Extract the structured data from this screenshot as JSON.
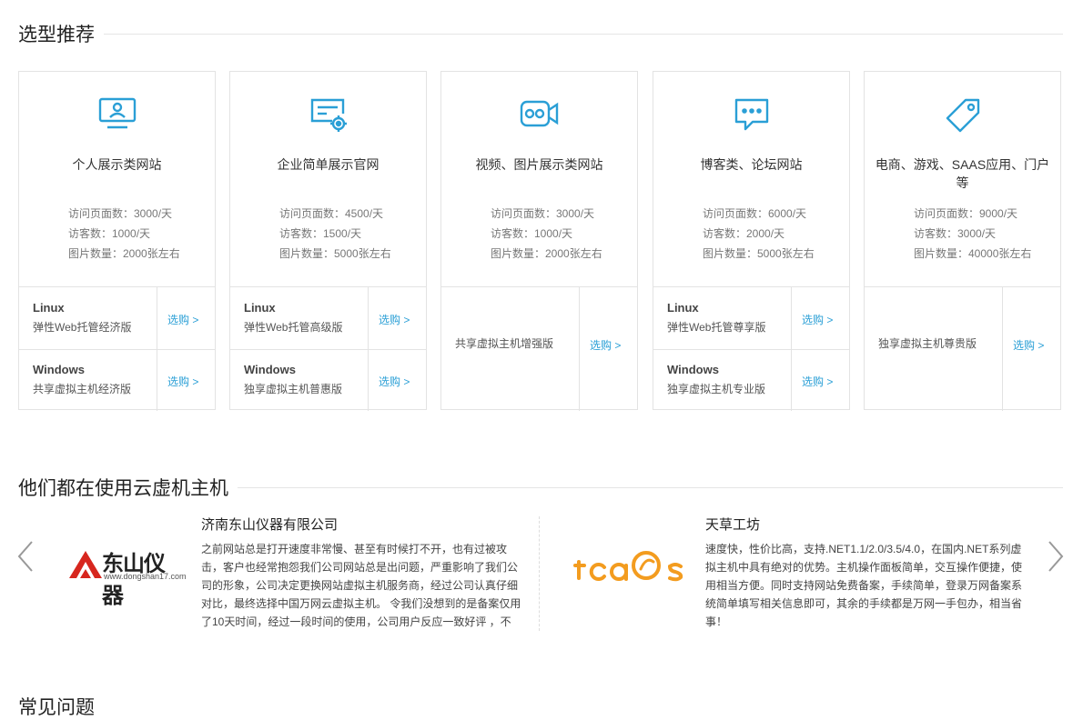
{
  "section1": {
    "title": "选型推荐"
  },
  "cards": [
    {
      "title": "个人展示类网站",
      "icon": "monitor-user-icon",
      "stats": [
        "访问页面数：3000/天",
        "访客数：1000/天",
        "图片数量：2000张左右"
      ],
      "rows": [
        {
          "os": "Linux",
          "plan": "弹性Web托管经济版",
          "select": "选购 >"
        },
        {
          "os": "Windows",
          "plan": "共享虚拟主机经济版",
          "select": "选购 >"
        }
      ]
    },
    {
      "title": "企业简单展示官网",
      "icon": "certificate-gear-icon",
      "stats": [
        "访问页面数：4500/天",
        "访客数：1500/天",
        "图片数量：5000张左右"
      ],
      "rows": [
        {
          "os": "Linux",
          "plan": "弹性Web托管高级版",
          "select": "选购 >"
        },
        {
          "os": "Windows",
          "plan": "独享虚拟主机普惠版",
          "select": "选购 >"
        }
      ]
    },
    {
      "title": "视频、图片展示类网站",
      "icon": "video-camera-icon",
      "stats": [
        "访问页面数：3000/天",
        "访客数：1000/天",
        "图片数量：2000张左右"
      ],
      "single": {
        "plan": "共享虚拟主机增强版",
        "select": "选购 >"
      }
    },
    {
      "title": "博客类、论坛网站",
      "icon": "chat-bubble-icon",
      "stats": [
        "访问页面数：6000/天",
        "访客数：2000/天",
        "图片数量：5000张左右"
      ],
      "rows": [
        {
          "os": "Linux",
          "plan": "弹性Web托管尊享版",
          "select": "选购 >"
        },
        {
          "os": "Windows",
          "plan": "独享虚拟主机专业版",
          "select": "选购 >"
        }
      ]
    },
    {
      "title": "电商、游戏、SAAS应用、门户等",
      "icon": "price-tag-icon",
      "stats": [
        "访问页面数：9000/天",
        "访客数：3000/天",
        "图片数量：40000张左右"
      ],
      "single": {
        "plan": "独享虚拟主机尊贵版",
        "select": "选购 >"
      }
    }
  ],
  "section2": {
    "title": "他们都在使用云虚机主机"
  },
  "cases": [
    {
      "name": "济南东山仪器有限公司",
      "logo_text": "东山仪器",
      "logo_sub": "www.dongshan17.com",
      "desc": "之前网站总是打开速度非常慢、甚至有时候打不开，也有过被攻击，客户也经常抱怨我们公司网站总是出问题，严重影响了我们公司的形象，公司决定更换网站虚拟主机服务商，经过公司认真仔细对比，最终选择中国万网云虚拟主机。 令我们没想到的是备案仅用了10天时间，经过一段时间的使用，公司用户反应一致好评 ，不"
    },
    {
      "name": "天草工坊",
      "logo_text": "tcaos",
      "desc": "速度快，性价比高，支持.NET1.1/2.0/3.5/4.0，在国内.NET系列虚拟主机中具有绝对的优势。主机操作面板简单，交互操作便捷，使用相当方便。同时支持网站免费备案，手续简单，登录万网备案系统简单填写相关信息即可，其余的手续都是万网一手包办，相当省事！"
    }
  ],
  "section3": {
    "title": "常见问题"
  },
  "colors": {
    "accent": "#2a9fd6",
    "logo_red": "#d7261e",
    "logo_orange": "#f39c1f"
  }
}
